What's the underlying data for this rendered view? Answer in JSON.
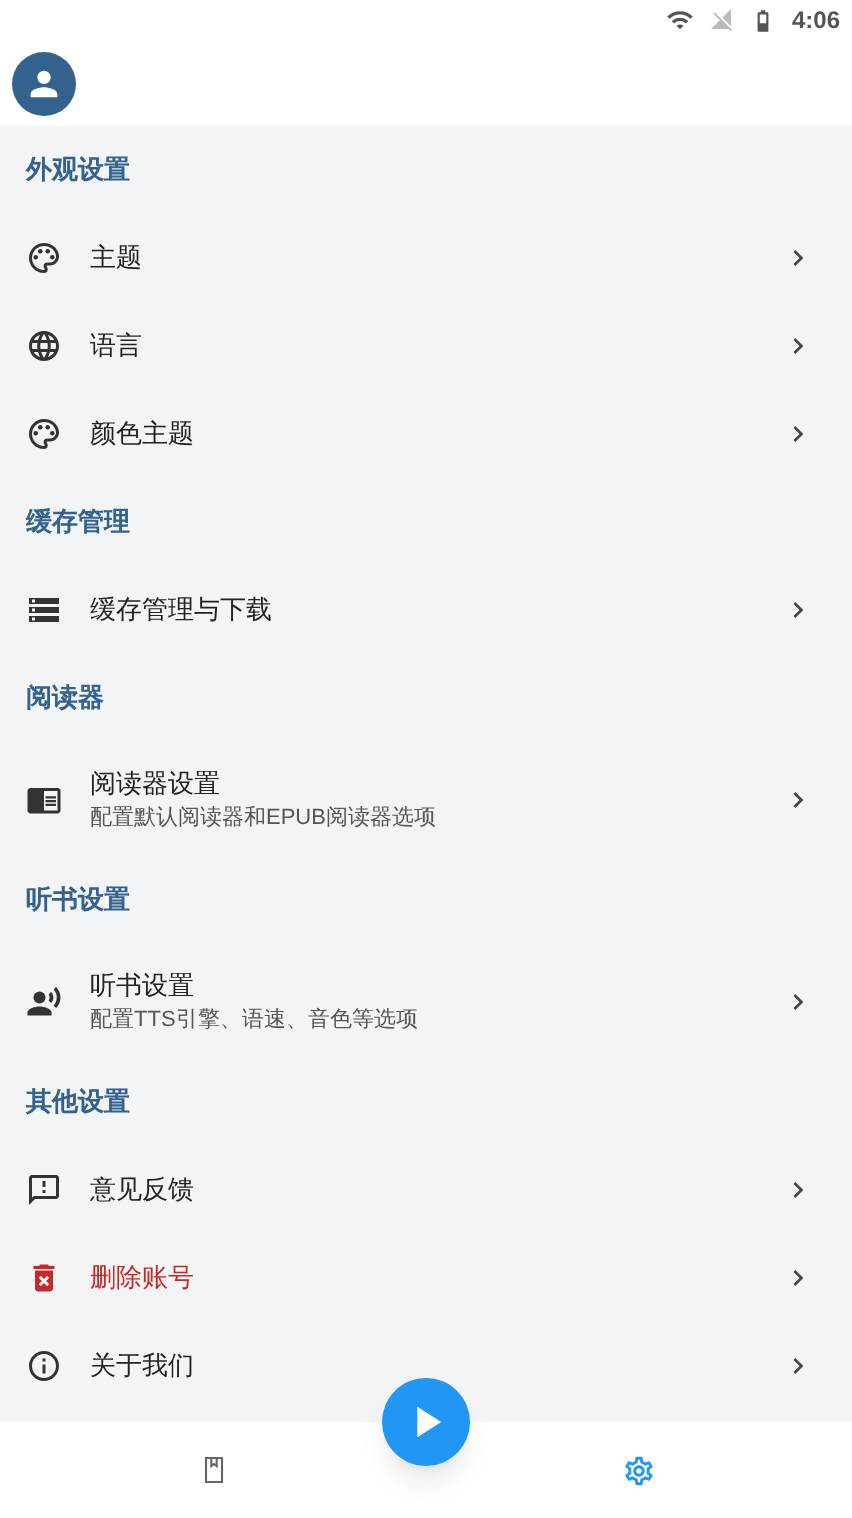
{
  "status_bar": {
    "time": "4:06"
  },
  "sections": [
    {
      "title": "外观设置",
      "items": [
        {
          "label": "主题",
          "kind": "normal"
        },
        {
          "label": "语言",
          "kind": "normal"
        },
        {
          "label": "颜色主题",
          "kind": "normal"
        }
      ]
    },
    {
      "title": "缓存管理",
      "items": [
        {
          "label": "缓存管理与下载",
          "kind": "normal"
        }
      ]
    },
    {
      "title": "阅读器",
      "items": [
        {
          "label": "阅读器设置",
          "subtitle": "配置默认阅读器和EPUB阅读器选项",
          "kind": "normal"
        }
      ]
    },
    {
      "title": "听书设置",
      "items": [
        {
          "label": "听书设置",
          "subtitle": "配置TTS引擎、语速、音色等选项",
          "kind": "normal"
        }
      ]
    },
    {
      "title": "其他设置",
      "items": [
        {
          "label": "意见反馈",
          "kind": "normal"
        },
        {
          "label": "删除账号",
          "kind": "danger"
        },
        {
          "label": "关于我们",
          "kind": "normal"
        }
      ]
    }
  ],
  "bottom_nav": [
    {
      "selected": false
    },
    {
      "selected": true
    }
  ]
}
